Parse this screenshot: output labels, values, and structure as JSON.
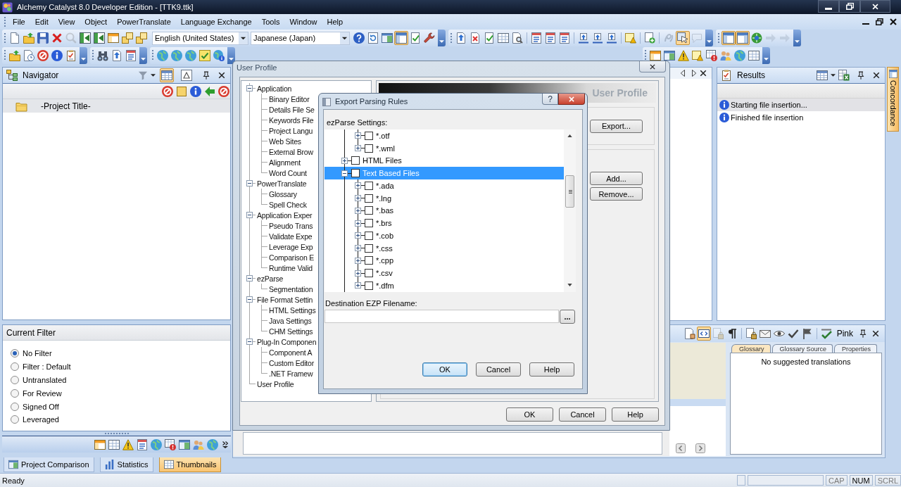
{
  "window": {
    "title": "Alchemy Catalyst 8.0 Developer Edition - [TTK9.ttk]"
  },
  "menu": [
    {
      "label": "File"
    },
    {
      "label": "Edit"
    },
    {
      "label": "View"
    },
    {
      "label": "Object"
    },
    {
      "label": "PowerTranslate"
    },
    {
      "label": "Language Exchange"
    },
    {
      "label": "Tools"
    },
    {
      "label": "Window"
    },
    {
      "label": "Help"
    }
  ],
  "toolbar": {
    "source_language": "English (United States)",
    "target_language": "Japanese (Japan)",
    "row_1_buttons": [
      {
        "on": false,
        "disabled": false
      },
      {
        "on": false,
        "disabled": false
      },
      {
        "on": false,
        "disabled": false
      },
      {
        "on": false,
        "disabled": false
      },
      {
        "on": false,
        "disabled": true
      },
      {
        "on": false,
        "disabled": false
      },
      {
        "on": false,
        "disabled": false
      },
      {
        "on": false,
        "disabled": false
      },
      {
        "on": false,
        "disabled": false
      },
      {
        "on": false,
        "disabled": false
      },
      {
        "on": false,
        "disabled": false
      },
      {
        "on": false,
        "disabled": false
      },
      {
        "on": false,
        "disabled": false
      },
      {
        "on": true,
        "disabled": false
      },
      {
        "on": false,
        "disabled": false
      },
      {
        "on": false,
        "disabled": false
      },
      {
        "on": false,
        "disabled": false
      },
      {
        "on": false,
        "disabled": false
      },
      {
        "on": false,
        "disabled": false
      },
      {
        "on": false,
        "disabled": false
      },
      {
        "on": false,
        "disabled": false
      },
      {
        "on": false,
        "disabled": false
      },
      {
        "on": false,
        "disabled": false
      },
      {
        "on": false,
        "disabled": false
      },
      {
        "on": false,
        "disabled": false
      },
      {
        "on": false,
        "disabled": false
      },
      {
        "on": false,
        "disabled": false
      },
      {
        "on": false,
        "disabled": false
      },
      {
        "on": false,
        "disabled": false
      },
      {
        "on": false,
        "disabled": true
      },
      {
        "on": true,
        "disabled": false
      },
      {
        "on": false,
        "disabled": true
      },
      {
        "on": true,
        "disabled": false
      },
      {
        "on": true,
        "disabled": false
      },
      {
        "on": false,
        "disabled": false
      },
      {
        "on": false,
        "disabled": true
      },
      {
        "on": false,
        "disabled": true
      }
    ]
  },
  "navigator": {
    "title": "Navigator",
    "view_buttons": [
      {
        "on": true
      },
      {
        "on": false
      }
    ],
    "items": [
      {
        "label": "-Project Title-",
        "selected": true
      }
    ]
  },
  "current_filter": {
    "title": "Current Filter",
    "options": [
      {
        "label": "No Filter",
        "selected": true
      },
      {
        "label": "Filter : Default",
        "selected": false
      },
      {
        "label": "Untranslated",
        "selected": false
      },
      {
        "label": "For Review",
        "selected": false
      },
      {
        "label": "Signed Off",
        "selected": false
      },
      {
        "label": "Leveraged",
        "selected": false
      }
    ]
  },
  "left_tabs": [
    {
      "label": "Project Comparison",
      "selected": false
    },
    {
      "label": "Statistics",
      "selected": false
    },
    {
      "label": "Thumbnails",
      "selected": true
    }
  ],
  "results": {
    "title": "Results",
    "messages": [
      {
        "text": "Starting file insertion...",
        "selected": true
      },
      {
        "text": "Finished file insertion",
        "selected": false
      }
    ]
  },
  "concordance_tab": {
    "label": "Concordance"
  },
  "bottom_panel": {
    "title": "Pink",
    "toolbar_buttons": [
      {
        "on": false,
        "disabled": false
      },
      {
        "on": true,
        "disabled": false
      },
      {
        "on": false,
        "disabled": true
      },
      {
        "on": false,
        "disabled": false
      },
      {
        "on": false,
        "disabled": false
      },
      {
        "on": false,
        "disabled": false
      },
      {
        "on": false,
        "disabled": false
      },
      {
        "on": false,
        "disabled": false
      },
      {
        "on": false,
        "disabled": false
      },
      {
        "on": false,
        "disabled": false
      }
    ],
    "tabs": [
      {
        "label": "Glossary",
        "selected": true
      },
      {
        "label": "Glossary Source",
        "selected": false
      },
      {
        "label": "Properties",
        "selected": false
      }
    ],
    "message": "No suggested translations"
  },
  "user_profile_dialog": {
    "title": "User Profile",
    "tree": [
      {
        "label": "Application",
        "expanded": true,
        "children": [
          {
            "label": "Binary Editor"
          },
          {
            "label": "Details File Se"
          },
          {
            "label": "Keywords File"
          },
          {
            "label": "Project Langu"
          },
          {
            "label": "Web Sites"
          },
          {
            "label": "External Brow"
          },
          {
            "label": "Alignment"
          },
          {
            "label": "Word Count"
          }
        ]
      },
      {
        "label": "PowerTranslate",
        "expanded": true,
        "children": [
          {
            "label": "Glossary"
          },
          {
            "label": "Spell Check"
          }
        ]
      },
      {
        "label": "Application Exper",
        "expanded": true,
        "children": [
          {
            "label": "Pseudo Trans"
          },
          {
            "label": "Validate Expe"
          },
          {
            "label": "Leverage Exp"
          },
          {
            "label": "Comparison E"
          },
          {
            "label": "Runtime Valid"
          }
        ]
      },
      {
        "label": "ezParse",
        "expanded": true,
        "children": [
          {
            "label": "Segmentation"
          }
        ]
      },
      {
        "label": "File Format Settin",
        "expanded": true,
        "children": [
          {
            "label": "HTML Settings"
          },
          {
            "label": "Java Settings"
          },
          {
            "label": "CHM Settings"
          }
        ]
      },
      {
        "label": "Plug-In Componen",
        "expanded": true,
        "children": [
          {
            "label": "Component A"
          },
          {
            "label": "Custom Editor"
          },
          {
            "label": ".NET Framew"
          }
        ]
      },
      {
        "label": "User Profile"
      }
    ],
    "page_title": "User Profile",
    "side_buttons": [
      {
        "label": "Export..."
      },
      {
        "label": "Add..."
      },
      {
        "label": "Remove..."
      }
    ],
    "buttons": [
      {
        "label": "OK"
      },
      {
        "label": "Cancel"
      },
      {
        "label": "Help"
      }
    ]
  },
  "export_dialog": {
    "title": "Export Parsing Rules",
    "help_button": "?",
    "settings_label": "ezParse Settings:",
    "tree": [
      {
        "children": [
          {
            "label": "*.otf",
            "expanded": false,
            "checked": false,
            "selected": false
          },
          {
            "label": "*.wml",
            "expanded": false,
            "checked": false,
            "selected": false
          }
        ]
      },
      {
        "label": "HTML Files",
        "expanded": false,
        "checked": false,
        "selected": false
      },
      {
        "label": "Text Based Files",
        "expanded": true,
        "checked": false,
        "selected": true,
        "children": [
          {
            "label": "*.ada",
            "expanded": false,
            "checked": false,
            "selected": false
          },
          {
            "label": "*.lng",
            "expanded": false,
            "checked": false,
            "selected": false
          },
          {
            "label": "*.bas",
            "expanded": false,
            "checked": false,
            "selected": false
          },
          {
            "label": "*.brs",
            "expanded": false,
            "checked": false,
            "selected": false
          },
          {
            "label": "*.cob",
            "expanded": false,
            "checked": false,
            "selected": false
          },
          {
            "label": "*.css",
            "expanded": false,
            "checked": false,
            "selected": false
          },
          {
            "label": "*.cpp",
            "expanded": false,
            "checked": false,
            "selected": false
          },
          {
            "label": "*.csv",
            "expanded": false,
            "checked": false,
            "selected": false
          },
          {
            "label": "*.dfm",
            "expanded": false,
            "checked": false,
            "selected": false
          }
        ]
      }
    ],
    "filename_label": "Destination EZP Filename:",
    "browse_button": "...",
    "buttons": [
      {
        "label": "OK",
        "default": true
      },
      {
        "label": "Cancel",
        "default": false
      },
      {
        "label": "Help",
        "default": false
      }
    ]
  },
  "status_bar": {
    "text": "Ready",
    "indicators": [
      {
        "label": "CAP",
        "on": false
      },
      {
        "label": "NUM",
        "on": true
      },
      {
        "label": "SCRL",
        "on": false
      }
    ]
  }
}
